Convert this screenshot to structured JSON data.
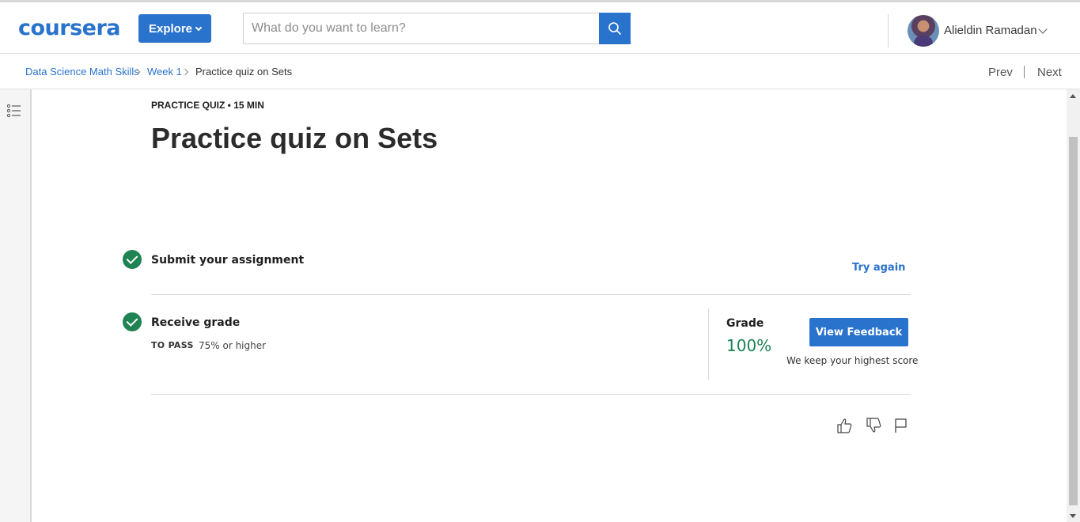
{
  "header": {
    "logo": "coursera",
    "explore_label": "Explore",
    "search_placeholder": "What do you want to learn?",
    "user_name": "Alieldin Ramadan"
  },
  "breadcrumb": {
    "items": [
      "Data Science Math Skills",
      "Week 1",
      "Practice quiz on Sets"
    ],
    "prev": "Prev",
    "next": "Next"
  },
  "quiz": {
    "eyebrow": "PRACTICE QUIZ • 15 MIN",
    "title": "Practice quiz on Sets"
  },
  "steps": {
    "submit": {
      "title": "Submit your assignment",
      "action": "Try again"
    },
    "receive": {
      "title": "Receive grade",
      "pass_label": "TO PASS",
      "pass_value": "75% or higher",
      "grade_label": "Grade",
      "grade_value": "100%",
      "feedback_button": "View Feedback",
      "note": "We keep your highest score"
    }
  },
  "colors": {
    "brand_blue": "#2a73cc",
    "success_green": "#1f8354"
  },
  "icons": [
    "search-icon",
    "chevron-down-icon",
    "table-of-contents-icon",
    "check-circle-icon",
    "thumbs-up-icon",
    "thumbs-down-icon",
    "flag-icon"
  ]
}
